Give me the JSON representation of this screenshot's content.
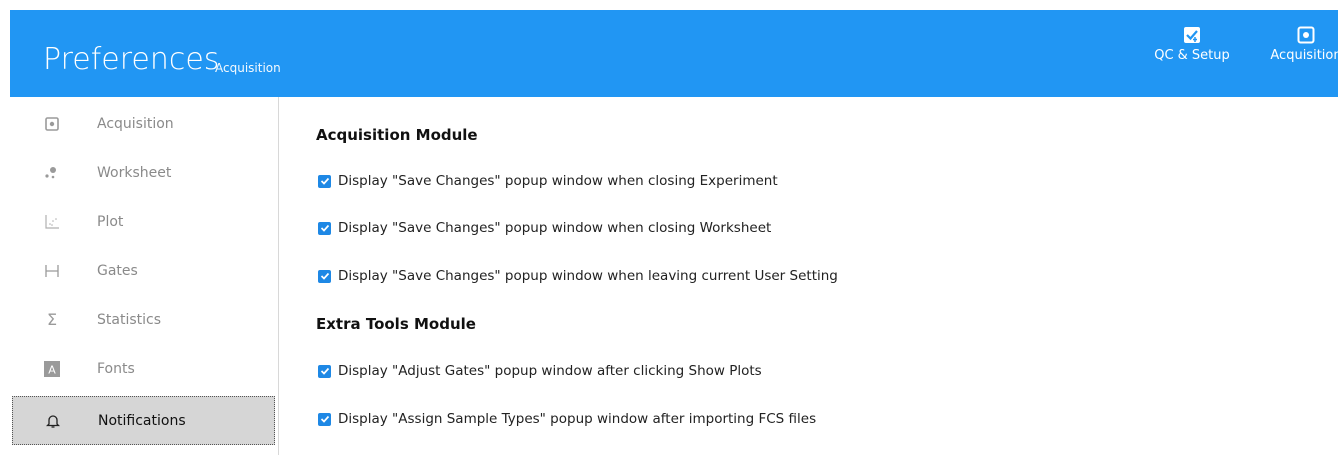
{
  "header": {
    "title": "Preferences",
    "subtitle": "Acquisition",
    "buttons": [
      {
        "label": "QC & Setup",
        "icon": "qc-setup-icon"
      },
      {
        "label": "Acquisition",
        "icon": "acquisition-icon"
      }
    ],
    "color": "#2196f3"
  },
  "sidebar": {
    "items": [
      {
        "label": "Acquisition",
        "icon": "acquisition-icon"
      },
      {
        "label": "Worksheet",
        "icon": "worksheet-icon"
      },
      {
        "label": "Plot",
        "icon": "plot-icon"
      },
      {
        "label": "Gates",
        "icon": "gates-icon"
      },
      {
        "label": "Statistics",
        "icon": "sigma-icon"
      },
      {
        "label": "Fonts",
        "icon": "font-icon"
      },
      {
        "label": "Notifications",
        "icon": "bell-icon",
        "selected": true
      }
    ]
  },
  "main": {
    "sections": [
      {
        "title": "Acquisition Module",
        "options": [
          {
            "label": "Display \"Save Changes\" popup window when closing Experiment",
            "checked": true
          },
          {
            "label": "Display \"Save Changes\" popup window when closing Worksheet",
            "checked": true
          },
          {
            "label": "Display \"Save Changes\" popup window when leaving current User Setting",
            "checked": true
          }
        ]
      },
      {
        "title": "Extra Tools Module",
        "options": [
          {
            "label": "Display \"Adjust Gates\" popup window after clicking Show Plots",
            "checked": true
          },
          {
            "label": "Display \"Assign Sample Types\" popup window after importing FCS files",
            "checked": true
          }
        ]
      }
    ]
  }
}
